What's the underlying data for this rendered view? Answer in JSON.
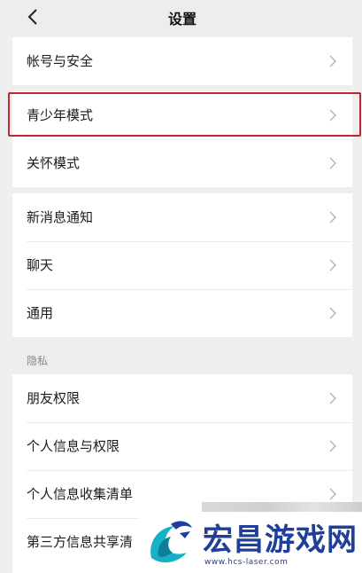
{
  "header": {
    "title": "设置",
    "back_icon": "chevron-left-icon"
  },
  "groups": [
    {
      "items": [
        {
          "label": "帐号与安全"
        }
      ]
    },
    {
      "items": [
        {
          "label": "青少年模式"
        },
        {
          "label": "关怀模式"
        }
      ]
    },
    {
      "items": [
        {
          "label": "新消息通知"
        },
        {
          "label": "聊天"
        },
        {
          "label": "通用"
        }
      ]
    }
  ],
  "privacy_section": {
    "title": "隐私",
    "items": [
      {
        "label": "朋友权限"
      },
      {
        "label": "个人信息与权限"
      },
      {
        "label": "个人信息收集清单"
      },
      {
        "label": "第三方信息共享清"
      }
    ]
  },
  "highlight": {
    "target": "青少年模式",
    "color": "#c0282f"
  },
  "watermark": {
    "title": "宏昌游戏网",
    "url": "www.hcs-laser.com",
    "color": "#1f3f99"
  },
  "colors": {
    "background": "#ededed",
    "row": "#ffffff",
    "chevron": "#b2b2b2"
  }
}
